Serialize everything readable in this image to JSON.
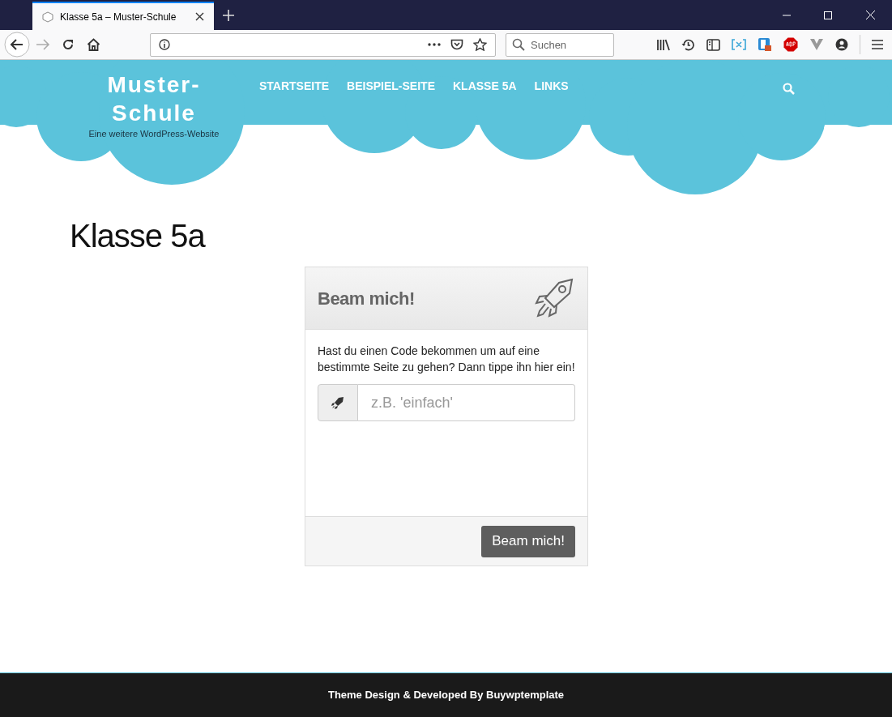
{
  "browser": {
    "tab_title": "Klasse 5a – Muster-Schule",
    "search_placeholder": "Suchen"
  },
  "site": {
    "title": "Muster-Schule",
    "tagline": "Eine weitere WordPress-Website",
    "nav": [
      {
        "label": "STARTSEITE"
      },
      {
        "label": "BEISPIEL-SEITE"
      },
      {
        "label": "KLASSE 5A"
      },
      {
        "label": "LINKS"
      }
    ]
  },
  "page": {
    "heading": "Klasse 5a"
  },
  "widget": {
    "title": "Beam mich!",
    "description": "Hast du einen Code bekommen um auf eine bestimmte Seite zu gehen? Dann tippe ihn hier ein!",
    "placeholder": "z.B. 'einfach'",
    "button": "Beam mich!"
  },
  "footer": {
    "text": "Theme Design & Developed By Buywptemplate"
  }
}
